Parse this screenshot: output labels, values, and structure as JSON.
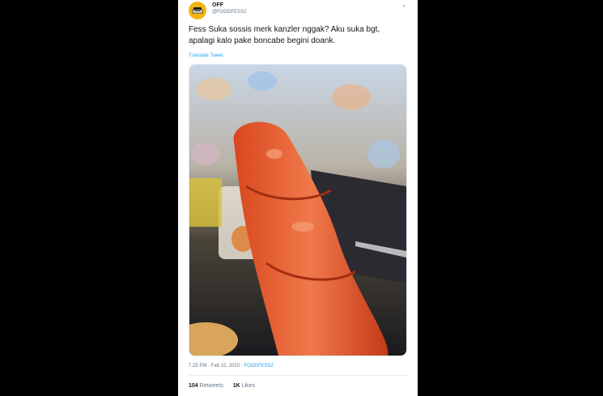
{
  "tweet": {
    "display_name": "OFF",
    "handle": "@FOODFESS2",
    "text": "Fess Suka sossis merk kanzler nggak? Aku suka bgt,\napalagi kalo pake boncabe begini doank.",
    "translate_label": "Translate Tweet",
    "time": "7:25 PM · Feb 15, 2020 · ",
    "source": "FOODFESS2",
    "retweets_count": "104",
    "retweets_label": "Retweets",
    "likes_count": "1K",
    "likes_label": "Likes"
  },
  "icons": {
    "avatar": "foodfess-logo",
    "menu": "chevron-down-icon"
  }
}
